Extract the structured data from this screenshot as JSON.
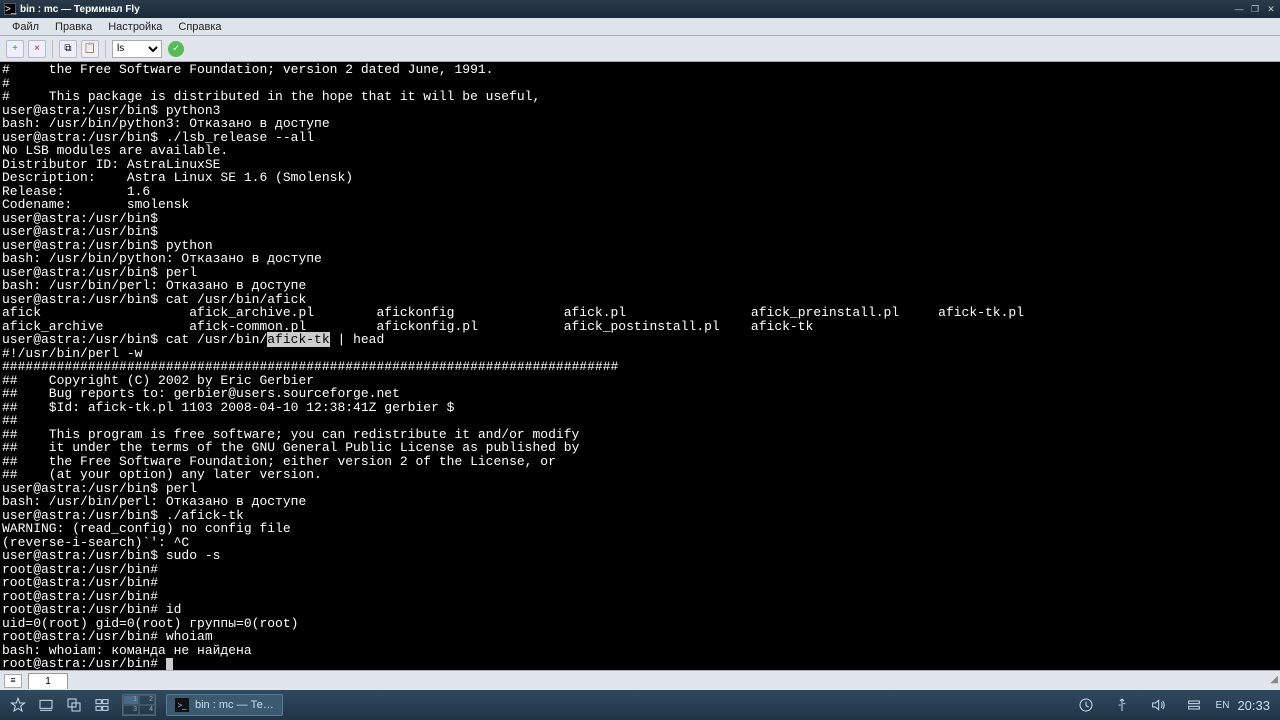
{
  "window": {
    "title": "bin : mc — Терминал Fly"
  },
  "menubar": [
    "Файл",
    "Правка",
    "Настройка",
    "Справка"
  ],
  "toolbar": {
    "select_value": "ls"
  },
  "terminal": {
    "highlight": "afick-tk",
    "lines": [
      "#     the Free Software Foundation; version 2 dated June, 1991.",
      "#",
      "#     This package is distributed in the hope that it will be useful,",
      "user@astra:/usr/bin$ python3",
      "bash: /usr/bin/python3: Отказано в доступе",
      "user@astra:/usr/bin$ ./lsb_release --all",
      "No LSB modules are available.",
      "Distributor ID: AstraLinuxSE",
      "Description:    Astra Linux SE 1.6 (Smolensk)",
      "Release:        1.6",
      "Codename:       smolensk",
      "user@astra:/usr/bin$",
      "user@astra:/usr/bin$",
      "user@astra:/usr/bin$ python",
      "bash: /usr/bin/python: Отказано в доступе",
      "user@astra:/usr/bin$ perl",
      "bash: /usr/bin/perl: Отказано в доступе",
      "user@astra:/usr/bin$ cat /usr/bin/afick",
      "afick                   afick_archive.pl        afickonfig              afick.pl                afick_preinstall.pl     afick-tk.pl",
      "afick_archive           afick-common.pl         afickonfig.pl           afick_postinstall.pl    afick-tk",
      "user@astra:/usr/bin$ cat /usr/bin/{{HL}} | head",
      "#!/usr/bin/perl -w",
      "###############################################################################",
      "##    Copyright (C) 2002 by Eric Gerbier",
      "##    Bug reports to: gerbier@users.sourceforge.net",
      "##    $Id: afick-tk.pl 1103 2008-04-10 12:38:41Z gerbier $",
      "##",
      "##    This program is free software; you can redistribute it and/or modify",
      "##    it under the terms of the GNU General Public License as published by",
      "##    the Free Software Foundation; either version 2 of the License, or",
      "##    (at your option) any later version.",
      "user@astra:/usr/bin$ perl",
      "bash: /usr/bin/perl: Отказано в доступе",
      "user@astra:/usr/bin$ ./afick-tk",
      "WARNING: (read_config) no config file",
      "(reverse-i-search)`': ^C",
      "user@astra:/usr/bin$ sudo -s",
      "root@astra:/usr/bin#",
      "root@astra:/usr/bin#",
      "root@astra:/usr/bin#",
      "root@astra:/usr/bin# id",
      "uid=0(root) gid=0(root) группы=0(root)",
      "root@astra:/usr/bin# whoiam",
      "bash: whoiam: команда не найдена",
      "root@astra:/usr/bin# "
    ]
  },
  "statusbar": {
    "tab": "1"
  },
  "taskbar": {
    "pager": [
      "1",
      "2",
      "3",
      "4"
    ],
    "task_label": "bin : mc — Те…",
    "lang": "EN",
    "clock": "20:33"
  }
}
